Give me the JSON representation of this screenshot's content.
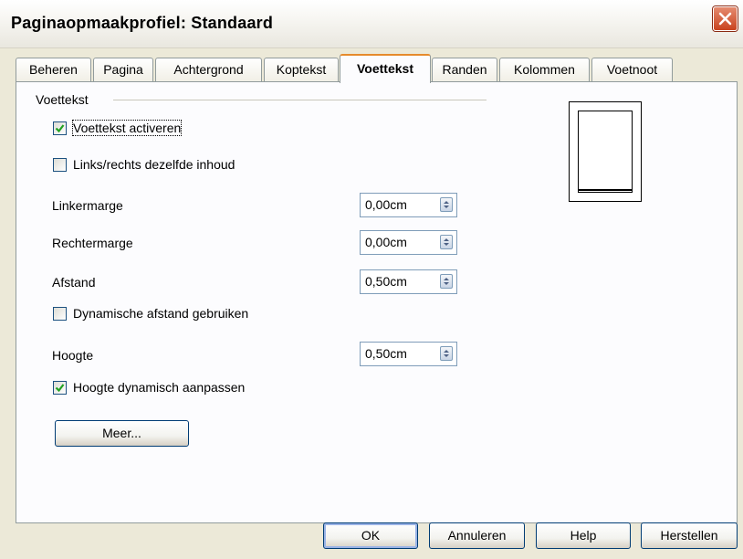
{
  "window": {
    "title": "Paginaopmaakprofiel: Standaard"
  },
  "tabs": [
    {
      "label": "Beheren"
    },
    {
      "label": "Pagina"
    },
    {
      "label": "Achtergrond"
    },
    {
      "label": "Koptekst"
    },
    {
      "label": "Voettekst",
      "active": true
    },
    {
      "label": "Randen"
    },
    {
      "label": "Kolommen"
    },
    {
      "label": "Voetnoot"
    }
  ],
  "footer_section": {
    "group_label": "Voettekst",
    "activate": {
      "label": "Voettekst activeren",
      "checked": true
    },
    "same_content": {
      "label": "Links/rechts dezelfde inhoud",
      "checked": false
    },
    "left_margin": {
      "label": "Linkermarge",
      "value": "0,00cm"
    },
    "right_margin": {
      "label": "Rechtermarge",
      "value": "0,00cm"
    },
    "spacing": {
      "label": "Afstand",
      "value": "0,50cm"
    },
    "dynamic_spacing": {
      "label": "Dynamische afstand gebruiken",
      "checked": false
    },
    "height": {
      "label": "Hoogte",
      "value": "0,50cm"
    },
    "autofit_height": {
      "label": "Hoogte dynamisch aanpassen",
      "checked": true
    },
    "more_button": "Meer..."
  },
  "buttons": {
    "ok": "OK",
    "cancel": "Annuleren",
    "help": "Help",
    "reset": "Herstellen"
  },
  "colors": {
    "dialog_bg": "#ece9d8",
    "active_tab_accent": "#e68b2c",
    "checkmark": "#21a121",
    "close_button": "#c9431f"
  }
}
